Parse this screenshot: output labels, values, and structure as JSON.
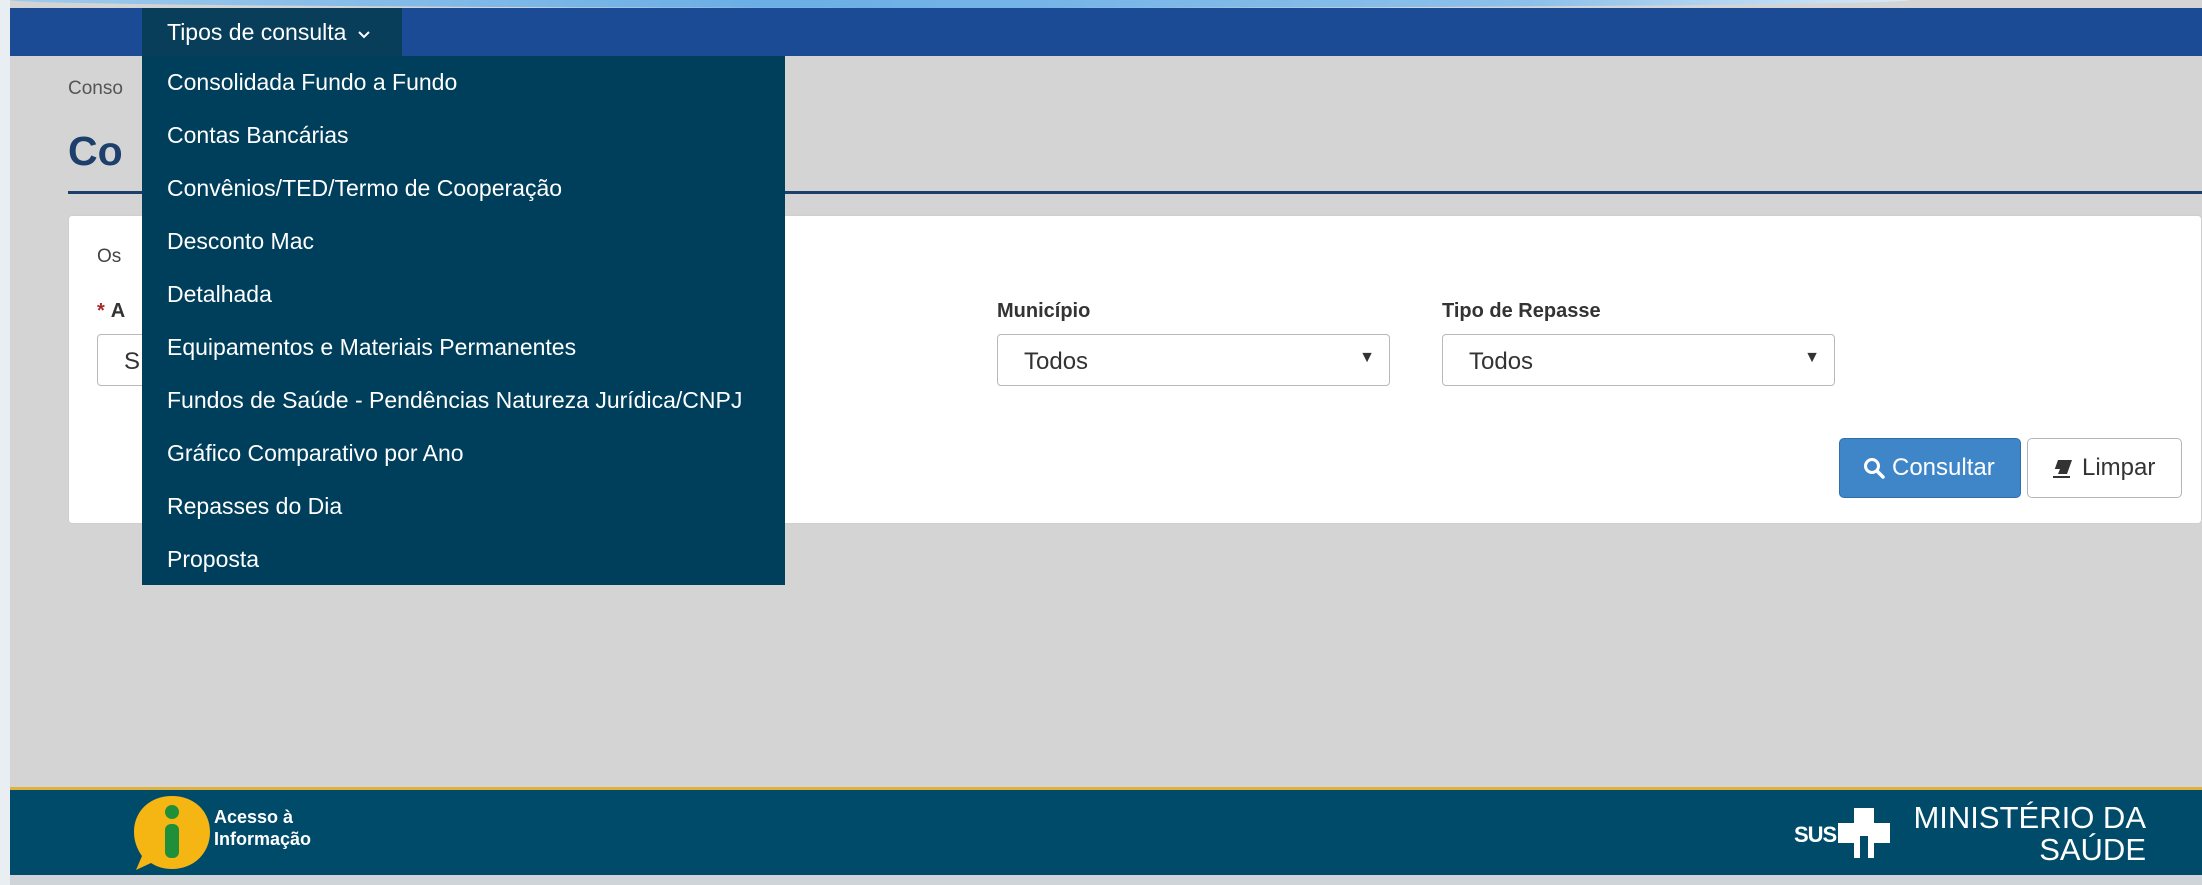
{
  "nav": {
    "menu_label": "Tipos de consulta",
    "menu_items": [
      "Consolidada Fundo a Fundo",
      "Contas Bancárias",
      "Convênios/TED/Termo de Cooperação",
      "Desconto Mac",
      "Detalhada",
      "Equipamentos e Materiais Permanentes",
      "Fundos de Saúde - Pendências Natureza Jurídica/CNPJ",
      "Gráfico Comparativo por Ano",
      "Repasses do Dia",
      "Proposta"
    ]
  },
  "breadcrumb": "Conso",
  "page_title": "Co",
  "panel": {
    "note": "Os",
    "required_label": "A",
    "required_value": "S",
    "municipio": {
      "label": "Município",
      "value": "Todos"
    },
    "tipo_repasse": {
      "label": "Tipo de Repasse",
      "value": "Todos"
    },
    "consultar_label": "Consultar",
    "limpar_label": "Limpar"
  },
  "footer": {
    "access_line1": "Acesso à",
    "access_line2": "Informação",
    "sus": "SUS",
    "ministry_line1": "MINISTÉRIO DA",
    "ministry_line2": "SAÚDE"
  },
  "colors": {
    "topbar": "#1a4b94",
    "menu": "#003f5c",
    "primary_button": "#3f86c8",
    "footer": "#004a6a",
    "footer_accent": "#e0b23a"
  }
}
